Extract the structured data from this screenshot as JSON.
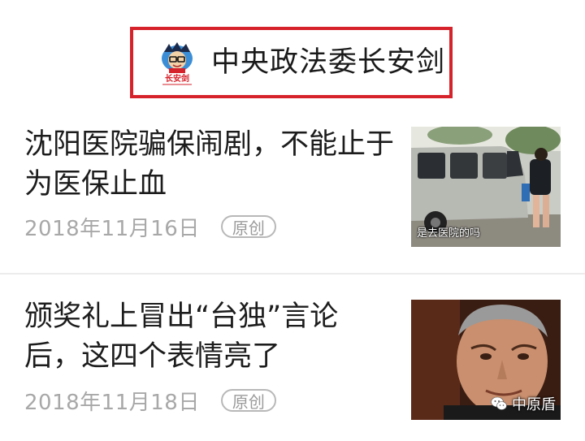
{
  "header": {
    "account_name": "中央政法委长安剑",
    "avatar_icon": "changanjian-avatar-icon",
    "avatar_text": "长安剑",
    "accent_color": "#d6222b"
  },
  "articles": [
    {
      "title": "沈阳医院骗保闹剧，不能止于为医保止血",
      "date": "2018年11月16日",
      "badge": "原创",
      "thumbnail_caption": "是去医院的吗"
    },
    {
      "title": "颁奖礼上冒出“台独”言论后，这四个表情亮了",
      "date": "2018年11月18日",
      "badge": "原创",
      "watermark_icon": "wechat-icon",
      "watermark_text": "中原盾"
    }
  ]
}
